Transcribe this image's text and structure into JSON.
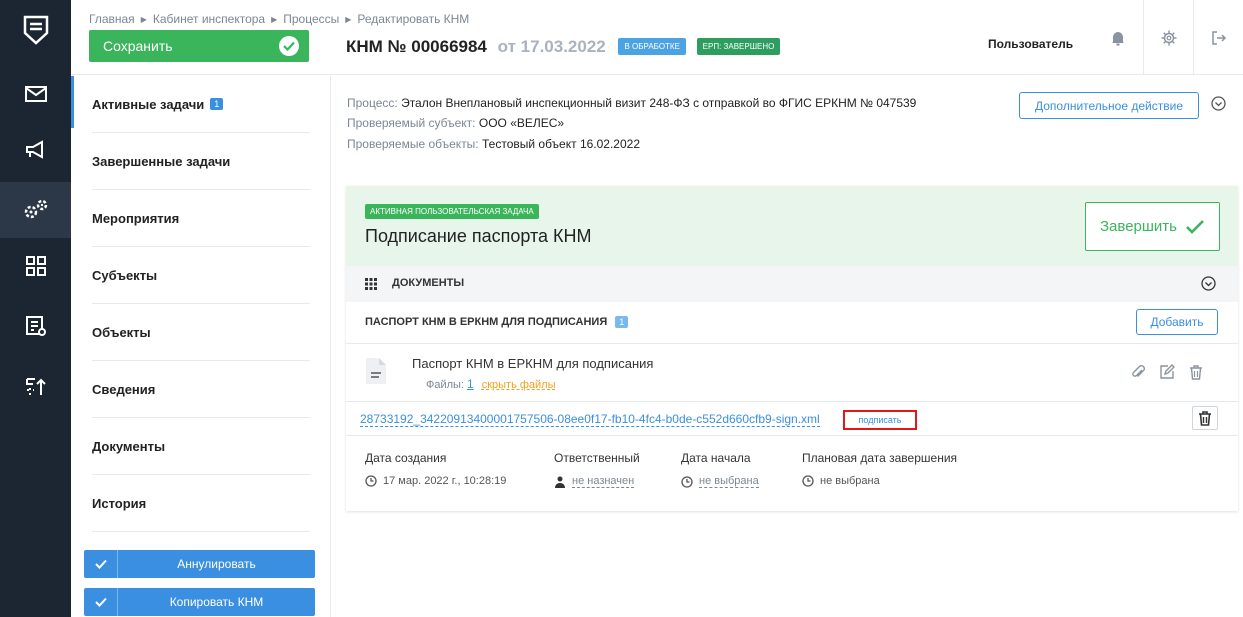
{
  "breadcrumb": [
    "Главная",
    "Кабинет инспектора",
    "Процессы",
    "Редактировать КНМ"
  ],
  "header": {
    "save_label": "Сохранить",
    "title_prefix": "КНМ",
    "title_no": "№",
    "title_number": "00066984",
    "title_from": "от",
    "title_date": "17.03.2022",
    "badge_status": "В ОБРАБОТКЕ",
    "badge_erp": "ЕРП: ЗАВЕРШЕНО",
    "user": "Пользователь"
  },
  "sidenav": {
    "items": [
      {
        "label": "Активные задачи",
        "badge": "1"
      },
      {
        "label": "Завершенные задачи"
      },
      {
        "label": "Мероприятия"
      },
      {
        "label": "Субъекты"
      },
      {
        "label": "Объекты"
      },
      {
        "label": "Сведения"
      },
      {
        "label": "Документы"
      },
      {
        "label": "История"
      }
    ],
    "annul_label": "Аннулировать",
    "copy_label": "Копировать КНМ"
  },
  "info": {
    "process_key": "Процесс:",
    "process_value": "Эталон Внеплановый инспекционный визит 248-ФЗ с отправкой во ФГИС ЕРКНМ № 047539",
    "subject_key": "Проверяемый субъект:",
    "subject_value": "ООО «ВЕЛЕС»",
    "objects_key": "Проверяемые объекты:",
    "objects_value": "Тестовый объект 16.02.2022",
    "extra_action": "Дополнительное действие"
  },
  "task": {
    "label": "АКТИВНАЯ ПОЛЬЗОВАТЕЛЬСКАЯ ЗАДАЧА",
    "title": "Подписание паспорта КНМ",
    "finish_label": "Завершить",
    "docs_label": "ДОКУМЕНТЫ",
    "section_label": "ПАСПОРТ КНМ В ЕРКНМ ДЛЯ ПОДПИСАНИЯ",
    "section_count": "1",
    "add_label": "Добавить",
    "doc_name": "Паспорт КНМ в ЕРКНМ для подписания",
    "files_label": "Файлы:",
    "files_count": "1",
    "hide_files": "скрыть файлы",
    "file_link": "28733192_34220913400001757506-08ee0f17-fb10-4fc4-b0de-c552d660cfb9-sign.xml",
    "sign_label": "подписать",
    "meta": {
      "created_key": "Дата создания",
      "created_value": "17 мар. 2022 г., 10:28:19",
      "responsible_key": "Ответственный",
      "responsible_value": "не назначен",
      "start_key": "Дата начала",
      "start_value": "не выбрана",
      "planned_key": "Плановая дата завершения",
      "planned_value": "не выбрана"
    }
  },
  "colors": {
    "rail": "#1c2532",
    "accent": "#3a8fe0",
    "success": "#3bb55b",
    "highlight": "#e01818"
  }
}
